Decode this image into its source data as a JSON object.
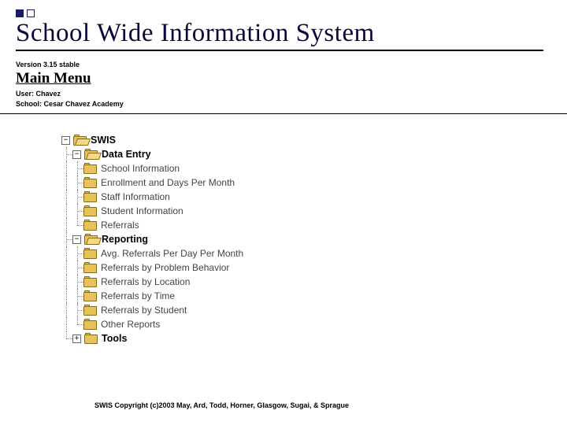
{
  "header": {
    "app_title": "School Wide Information System",
    "version": "Version 3.15 stable",
    "page_heading": "Main Menu",
    "user_label": "User:",
    "user_value": "Chavez",
    "school_label": "School:",
    "school_value": "Cesar Chavez Academy"
  },
  "tree": {
    "root": {
      "label": "SWIS",
      "expander": "−"
    },
    "sections": [
      {
        "label": "Data Entry",
        "expander": "−",
        "children": [
          "School Information",
          "Enrollment and Days Per Month",
          "Staff Information",
          "Student Information",
          "Referrals"
        ]
      },
      {
        "label": "Reporting",
        "expander": "−",
        "children": [
          "Avg. Referrals Per Day Per Month",
          "Referrals by Problem Behavior",
          "Referrals by Location",
          "Referrals by Time",
          "Referrals by Student",
          "Other Reports"
        ]
      },
      {
        "label": "Tools",
        "expander": "+",
        "children": []
      }
    ]
  },
  "footer": {
    "copyright": "SWIS Copyright (c)2003 May, Ard, Todd, Horner, Glasgow, Sugai, & Sprague"
  }
}
